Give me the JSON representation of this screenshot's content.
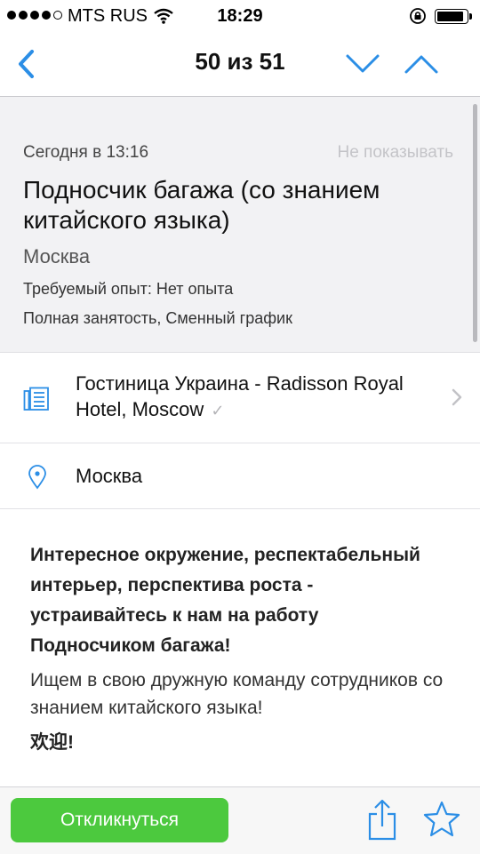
{
  "status_bar": {
    "carrier": "MTS RUS",
    "time": "18:29",
    "battery_level": 0.9
  },
  "nav": {
    "title": "50 из 51"
  },
  "vacancy": {
    "posted": "Сегодня в 13:16",
    "hide_label": "Не показывать",
    "title": "Подносчик багажа (со знанием китайского языка)",
    "city": "Москва",
    "experience": "Требуемый опыт: Нет опыта",
    "employment": "Полная занятость, Сменный график"
  },
  "company": {
    "name": "Гостиница Украина - Radisson Royal Hotel, Moscow",
    "verified_mark": "✓"
  },
  "location": {
    "address": "Москва"
  },
  "description": {
    "bold": "Интересное окружение, респектабельный интерьер, перспектива роста - устраивайтесь к нам на работу Подносчиком багажа!",
    "text": "Ищем в свою дружную команду сотрудников со знанием китайского языка!",
    "greeting": "欢迎!"
  },
  "actions": {
    "respond_label": "Откликнуться"
  },
  "colors": {
    "accent": "#2b8ee6",
    "respond_button": "#4cc93e",
    "header_bg": "#f2f2f4"
  },
  "icons": {
    "back": "chevron-left-icon",
    "next": "chevron-down-icon",
    "prev": "chevron-up-icon",
    "company": "building-icon",
    "location": "map-pin-icon",
    "share": "share-icon",
    "favorite": "star-icon"
  }
}
